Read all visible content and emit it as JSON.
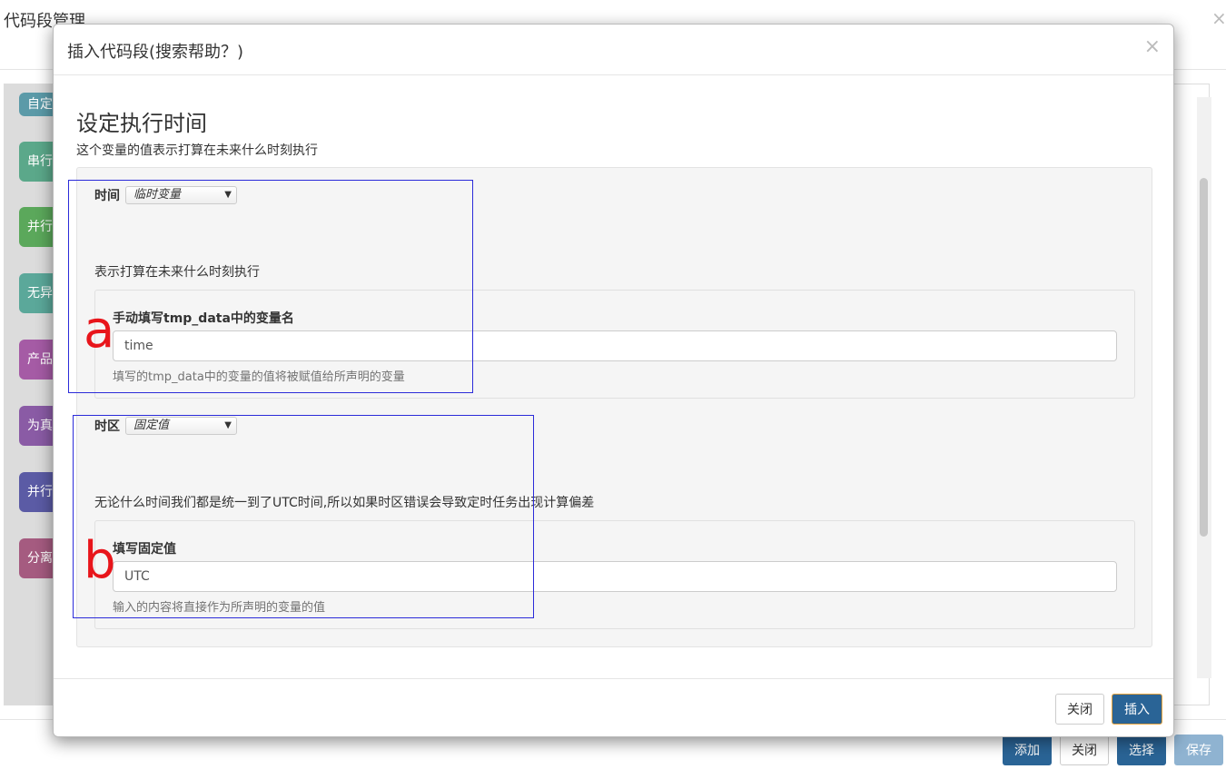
{
  "background": {
    "title": "代码段管理",
    "close": "×",
    "blocks": [
      {
        "label": "自定",
        "color": "#5b9aa8"
      },
      {
        "label": "串行",
        "color": "#5ba88a"
      },
      {
        "label": "并行",
        "color": "#5ba85b"
      },
      {
        "label": "无异",
        "color": "#5ba89a"
      },
      {
        "label": "产品",
        "color": "#a55ba5"
      },
      {
        "label": "为真",
        "color": "#8a5ba5"
      },
      {
        "label": "并行",
        "color": "#5b5ba5"
      },
      {
        "label": "分离",
        "color": "#a55b80"
      }
    ],
    "buttons": {
      "add": "添加",
      "close": "关闭",
      "select": "选择",
      "save": "保存"
    }
  },
  "modal": {
    "title": "插入代码段(搜索帮助？)",
    "close": "×",
    "heading": "设定执行时间",
    "subtitle": "这个变量的值表示打算在未来什么时刻执行",
    "time_field": {
      "label": "时间",
      "select_value": "临时变量",
      "description": "表示打算在未来什么时刻执行",
      "sub_label": "手动填写tmp_data中的变量名",
      "input_value": "time",
      "help": "填写的tmp_data中的变量的值将被赋值给所声明的变量"
    },
    "tz_field": {
      "label": "时区",
      "select_value": "固定值",
      "description": "无论什么时间我们都是统一到了UTC时间,所以如果时区错误会导致定时任务出现计算偏差",
      "sub_label": "填写固定值",
      "input_value": "UTC",
      "help": "输入的内容将直接作为所声明的变量的值"
    },
    "footer": {
      "close": "关闭",
      "insert": "插入"
    }
  },
  "annotations": {
    "a": "a",
    "b": "b",
    "box_color": "#2b2bd9",
    "letter_color": "#e8151b"
  }
}
